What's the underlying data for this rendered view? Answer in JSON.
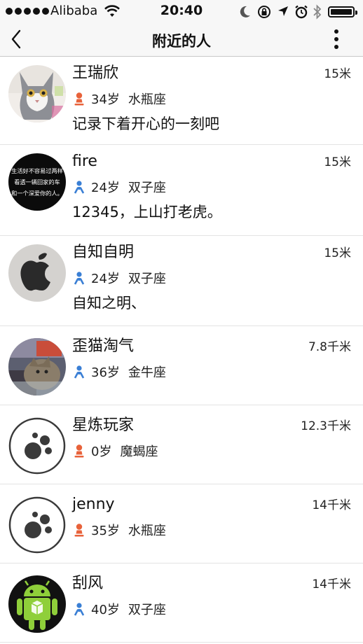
{
  "status_bar": {
    "carrier": "Alibaba",
    "time": "20:40",
    "icons": [
      "signal-dots",
      "wifi-icon",
      "moon-icon",
      "rotation-lock-icon",
      "location-arrow-icon",
      "alarm-icon",
      "bluetooth-icon",
      "battery-icon"
    ]
  },
  "nav": {
    "title": "附近的人",
    "back_icon": "chevron-left-icon",
    "more_icon": "vertical-ellipsis-icon"
  },
  "colors": {
    "male": "#3a7fd5",
    "female": "#e8623a"
  },
  "people": [
    {
      "name": "王瑞欣",
      "gender": "female",
      "age": "34岁",
      "zodiac": "水瓶座",
      "signature": "记录下着开心的一刻吧",
      "distance": "15米",
      "avatar": "cat-photo"
    },
    {
      "name": "fire",
      "gender": "male",
      "age": "24岁",
      "zodiac": "双子座",
      "signature": "12345，上山打老虎。",
      "distance": "15米",
      "avatar": "text-image",
      "avatar_text": [
        "生活好不容易过两样",
        "看透一辆回家的车",
        "和一个深爱你的人。"
      ]
    },
    {
      "name": "自知自明",
      "gender": "male",
      "age": "24岁",
      "zodiac": "双子座",
      "signature": "自知之明、",
      "distance": "15米",
      "avatar": "apple-logo"
    },
    {
      "name": "歪猫淘气",
      "gender": "male",
      "age": "36岁",
      "zodiac": "金牛座",
      "signature": "",
      "distance": "7.8千米",
      "avatar": "cat-on-laptop-photo"
    },
    {
      "name": "星炼玩家",
      "gender": "female",
      "age": "0岁",
      "zodiac": "魔蝎座",
      "signature": "",
      "distance": "12.3千米",
      "avatar": "default-paw"
    },
    {
      "name": "jenny",
      "gender": "female",
      "age": "35岁",
      "zodiac": "水瓶座",
      "signature": "",
      "distance": "14千米",
      "avatar": "default-paw"
    },
    {
      "name": "刮风",
      "gender": "male",
      "age": "40岁",
      "zodiac": "双子座",
      "signature": "",
      "distance": "14千米",
      "avatar": "android-robot"
    }
  ]
}
